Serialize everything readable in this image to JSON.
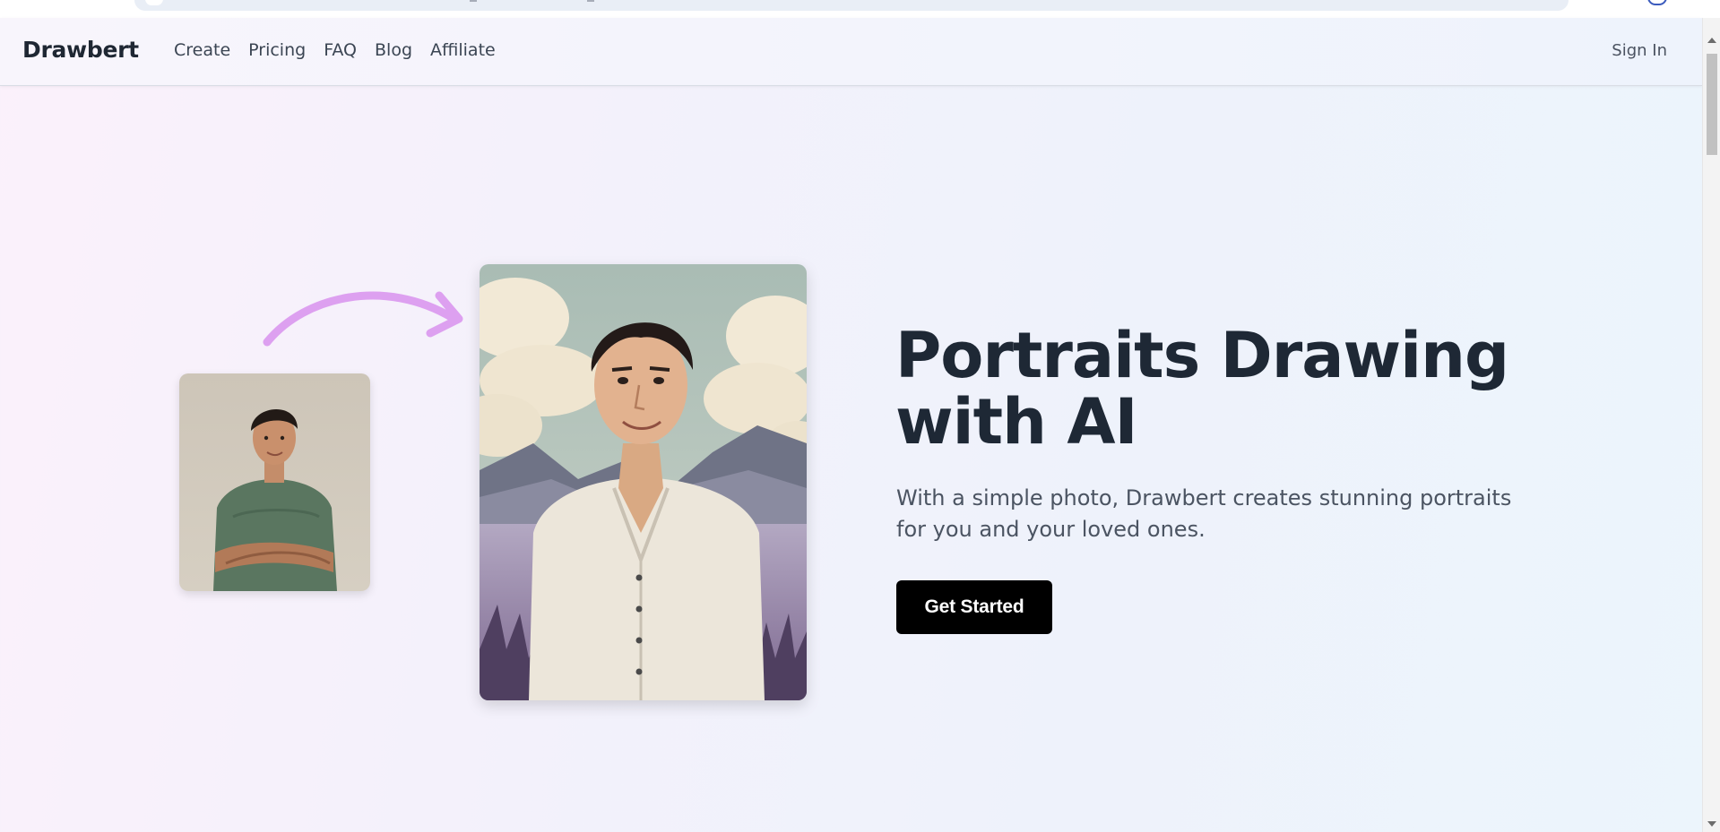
{
  "nav": {
    "brand": "Drawbert",
    "links": [
      "Create",
      "Pricing",
      "FAQ",
      "Blog",
      "Affiliate"
    ],
    "sign_in": "Sign In"
  },
  "hero": {
    "title_line1": "Portraits Drawing",
    "title_line2": "with AI",
    "subtitle": "With a simple photo, Drawbert creates stunning portraits for you and your loved ones.",
    "cta_label": "Get Started"
  },
  "colors": {
    "arrow": "#dda0f0",
    "cta_bg": "#000000",
    "title": "#1e2835"
  },
  "icons": {
    "arrow": "curved-arrow-icon"
  }
}
